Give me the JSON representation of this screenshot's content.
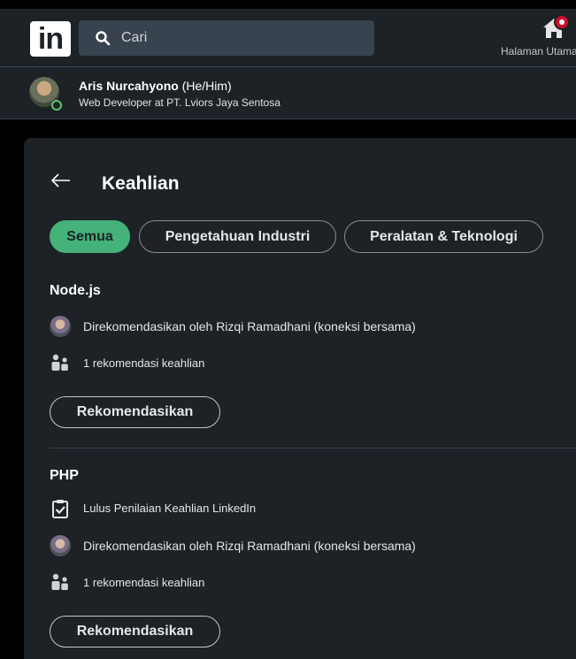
{
  "header": {
    "logo_text": "in",
    "search_placeholder": "Cari",
    "home_label": "Halaman Utama"
  },
  "profile": {
    "name": "Aris Nurcahyono",
    "pronouns": "(He/Him)",
    "headline": "Web Developer at PT. Lviors Jaya Sentosa"
  },
  "page": {
    "title": "Keahlian",
    "filters": [
      "Semua",
      "Pengetahuan Industri",
      "Peralatan & Teknologi"
    ],
    "active_filter": "Semua"
  },
  "skills": [
    {
      "name": "Node.js",
      "endorsed_by": "Direkomendasikan oleh Rizqi Ramadhani (koneksi bersama)",
      "endorsement_count": "1 rekomendasi keahlian",
      "button": "Rekomendasikan"
    },
    {
      "name": "PHP",
      "assessment": "Lulus Penilaian Keahlian LinkedIn",
      "endorsed_by": "Direkomendasikan oleh Rizqi Ramadhani (koneksi bersama)",
      "endorsement_count": "1 rekomendasi keahlian",
      "button": "Rekomendasikan"
    }
  ],
  "colors": {
    "background": "#000000",
    "surface": "#1d2226",
    "accent_green": "#44b279",
    "notification_red": "#cb112d"
  }
}
